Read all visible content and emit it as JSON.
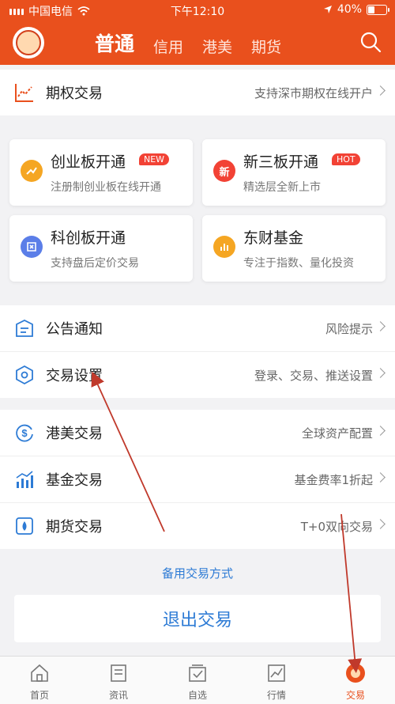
{
  "status": {
    "carrier": "中国电信",
    "time": "下午12:10",
    "battery": "40%",
    "battery_level": 0.4
  },
  "header": {
    "tabs": [
      "普通",
      "信用",
      "港美",
      "期货"
    ],
    "active": 0
  },
  "options_row": {
    "title": "期权交易",
    "sub": "支持深市期权在线开户"
  },
  "tiles": [
    {
      "name": "创业板开通",
      "desc": "注册制创业板在线开通",
      "badge": "NEW",
      "icon": "trend-icon",
      "color": "#f5a623"
    },
    {
      "name": "新三板开通",
      "desc": "精选层全新上市",
      "badge": "HOT",
      "icon_text": "新",
      "color": "#f24235"
    },
    {
      "name": "科创板开通",
      "desc": "支持盘后定价交易",
      "icon": "kechuang-icon",
      "color": "#5b7ee8"
    },
    {
      "name": "东财基金",
      "desc": "专注于指数、量化投资",
      "icon": "fund-chart-icon",
      "color": "#f5a623"
    }
  ],
  "rows_a": [
    {
      "title": "公告通知",
      "sub": "风险提示"
    },
    {
      "title": "交易设置",
      "sub": "登录、交易、推送设置"
    }
  ],
  "rows_b": [
    {
      "title": "港美交易",
      "sub": "全球资产配置"
    },
    {
      "title": "基金交易",
      "sub": "基金费率1折起"
    },
    {
      "title": "期货交易",
      "sub": "T+0双向交易"
    }
  ],
  "alt_link": "备用交易方式",
  "exit_label": "退出交易",
  "tabbar": [
    "首页",
    "资讯",
    "自选",
    "行情",
    "交易"
  ],
  "tabbar_active": 4,
  "colors": {
    "brand": "#e9501d",
    "link": "#2d7bd5"
  }
}
